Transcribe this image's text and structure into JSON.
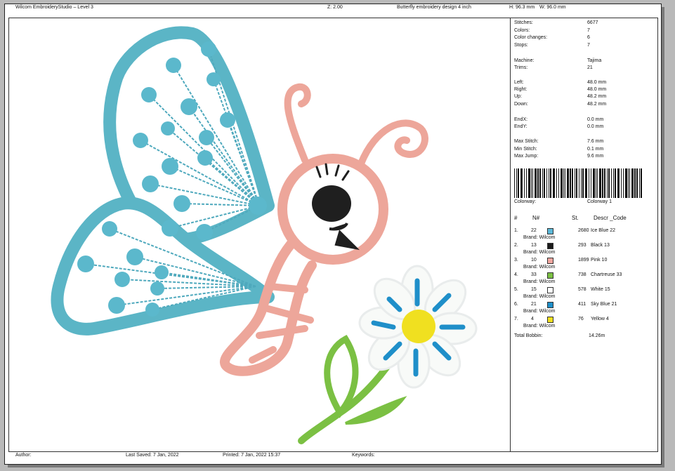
{
  "header": {
    "app_title": "Wilcom EmbroideryStudio – Level 3",
    "zoom": "Z: 2.00",
    "design_name": "Butterfly embroidery design 4 inch",
    "height": "H: 96.3 mm",
    "width": "W: 96.0 mm"
  },
  "stats": [
    {
      "label": "Stitches:",
      "value": "6677"
    },
    {
      "label": "Colors:",
      "value": "7"
    },
    {
      "label": "Color changes:",
      "value": "6"
    },
    {
      "label": "Stops:",
      "value": "7"
    },
    {
      "label": "Machine:",
      "value": "Tajima"
    },
    {
      "label": "Trims:",
      "value": "21"
    },
    {
      "label": "Left:",
      "value": "48.0 mm"
    },
    {
      "label": "Right:",
      "value": "48.0 mm"
    },
    {
      "label": "Up:",
      "value": "48.2 mm"
    },
    {
      "label": "Down:",
      "value": "48.2 mm"
    },
    {
      "label": "EndX:",
      "value": "0.0 mm"
    },
    {
      "label": "EndY:",
      "value": "0.0 mm"
    },
    {
      "label": "Max Stitch:",
      "value": "7.6 mm"
    },
    {
      "label": "Min Stitch:",
      "value": "0.1 mm"
    },
    {
      "label": "Max Jump:",
      "value": "9.6 mm"
    }
  ],
  "colorway": {
    "label": "Colorway:",
    "value": "Colorway 1"
  },
  "table_headers": {
    "num": "#",
    "n": "N#",
    "st": "St.",
    "descr": "Descr _Code"
  },
  "colors": [
    {
      "idx": "1.",
      "n": "22",
      "hex": "#5bb8d8",
      "st": "2680",
      "name": "Ice Blue 22",
      "brand": "Brand: Wilcom"
    },
    {
      "idx": "2.",
      "n": "13",
      "hex": "#1a1a1a",
      "st": "293",
      "name": "Black 13",
      "brand": "Brand: Wilcom"
    },
    {
      "idx": "3.",
      "n": "10",
      "hex": "#f2a7a0",
      "st": "1899",
      "name": "Pink 10",
      "brand": "Brand: Wilcom"
    },
    {
      "idx": "4.",
      "n": "33",
      "hex": "#7bc043",
      "st": "738",
      "name": "Chartreuse 33",
      "brand": "Brand: Wilcom"
    },
    {
      "idx": "5.",
      "n": "15",
      "hex": "#ffffff",
      "st": "578",
      "name": "White 15",
      "brand": "Brand: Wilcom"
    },
    {
      "idx": "6.",
      "n": "21",
      "hex": "#1f8fc9",
      "st": "411",
      "name": "Sky Blue 21",
      "brand": "Brand: Wilcom"
    },
    {
      "idx": "7.",
      "n": "4",
      "hex": "#f0e020",
      "st": "76",
      "name": "Yellow 4",
      "brand": "Brand: Wilcom"
    }
  ],
  "total_bobbin": {
    "label": "Total Bobbin:",
    "value": "14.26m"
  },
  "footer": {
    "author": "Author:",
    "last_saved": "Last Saved:  7 Jan, 2022",
    "printed": "Printed:  7 Jan, 2022 15:37",
    "keywords": "Keywords:"
  }
}
